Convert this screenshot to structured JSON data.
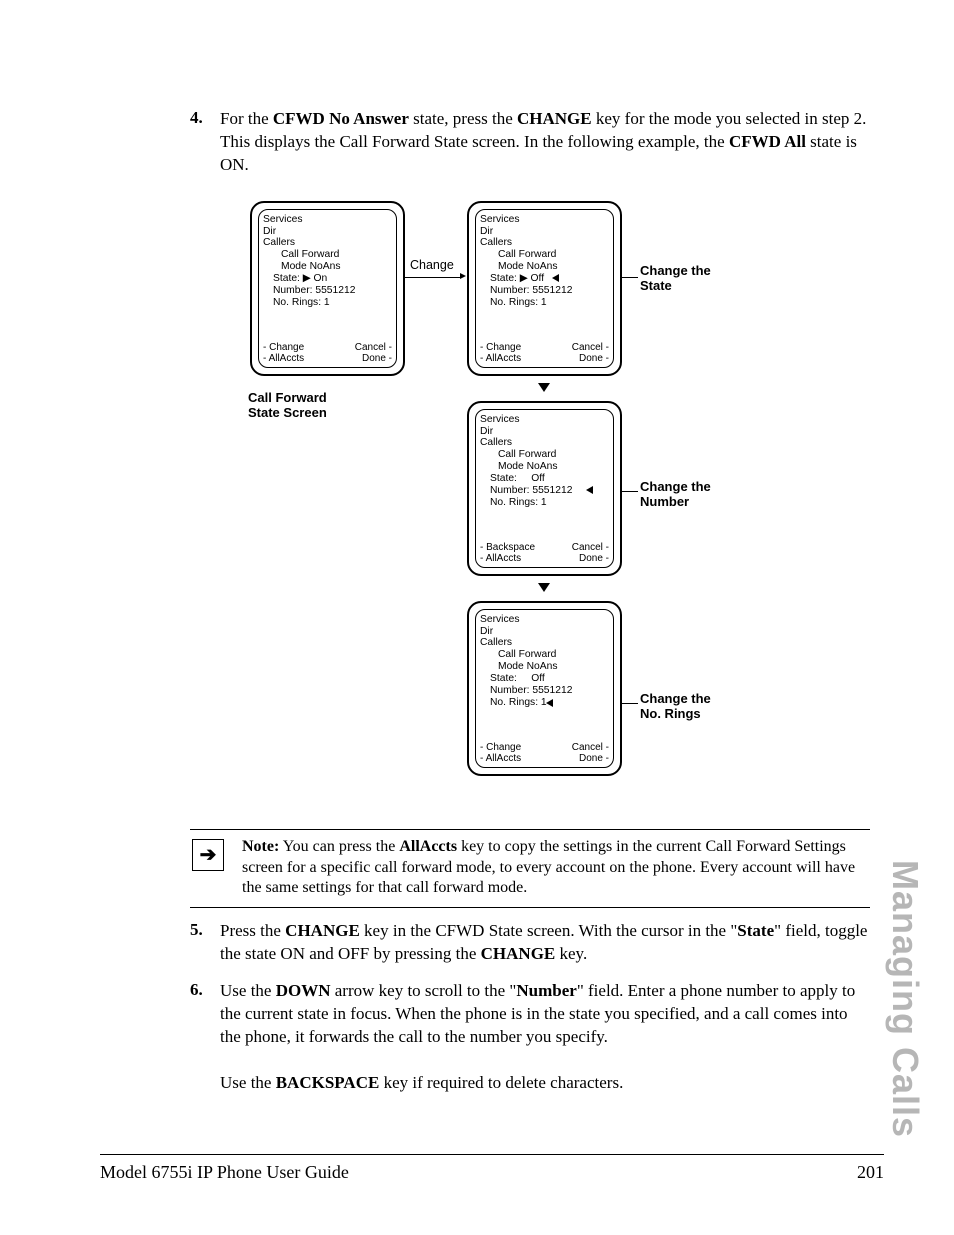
{
  "sidetab": "Managing Calls",
  "footer": {
    "left": "Model 6755i IP Phone User Guide",
    "right": "201"
  },
  "steps": {
    "s4": {
      "num": "4.",
      "p1a": "For the ",
      "p1b": "CFWD No Answer",
      "p1c": " state, press the ",
      "p1d": "CHANGE",
      "p1e": " key for the mode you selected in step 2. This displays the Call Forward State screen. In the following example, the ",
      "p1f": "CFWD All",
      "p1g": " state is ON."
    },
    "s5": {
      "num": "5.",
      "a": "Press the ",
      "b": "CHANGE",
      "c": " key in the CFWD State screen. With the cursor in the \"",
      "d": "State",
      "e": "\" field, toggle the state ON and OFF by pressing the ",
      "f": "CHANGE",
      "g": " key."
    },
    "s6": {
      "num": "6.",
      "a": "Use the ",
      "b": "DOWN",
      "c": " arrow key to scroll to the \"",
      "d": "Number",
      "e": "\" field. Enter a phone number to apply to the current state in focus. When the phone is in the state you specified, and a call comes into the phone, it forwards the call to the number you specify.",
      "p2a": "Use the ",
      "p2b": "BACKSPACE",
      "p2c": " key if required to delete characters."
    }
  },
  "note": {
    "lead": "Note:",
    "a": " You can press the ",
    "b": "AllAccts",
    "c": " key to copy the settings in the current Call Forward Settings screen for a specific call forward mode, to every account on the phone. Every account will have the same settings for that call forward mode."
  },
  "diagram": {
    "change_lbl": "Change",
    "label_state_screen": "Call Forward\nState Screen",
    "label_change_state": "Change the\nState",
    "label_change_number": "Change the\nNumber",
    "label_change_rings": "Change the\nNo. Rings",
    "s1": {
      "l0": "Services",
      "l1": "Dir",
      "l2": "Callers",
      "l3": "Call Forward",
      "l4": "Mode NoAns",
      "l5": "State: ▶ On",
      "l6": "Number: 5551212",
      "l7": "No. Rings: 1",
      "sk1l": "Change",
      "sk1r": "Cancel",
      "sk2l": "AllAccts",
      "sk2r": "Done"
    },
    "s2": {
      "l0": "Services",
      "l1": "Dir",
      "l2": "Callers",
      "l3": "Call Forward",
      "l4": "Mode NoAns",
      "l5": "State: ▶ Off",
      "l6": "Number: 5551212",
      "l7": "No. Rings: 1",
      "sk1l": "Change",
      "sk1r": "Cancel",
      "sk2l": "AllAccts",
      "sk2r": "Done"
    },
    "s3": {
      "l0": "Services",
      "l1": "Dir",
      "l2": "Callers",
      "l3": "Call Forward",
      "l4": "Mode NoAns",
      "l5": "State:     Off",
      "l6": "Number: 5551212",
      "l7": "No. Rings: 1",
      "sk1l": "Backspace",
      "sk1r": "Cancel",
      "sk2l": "AllAccts",
      "sk2r": "Done"
    },
    "s4": {
      "l0": "Services",
      "l1": "Dir",
      "l2": "Callers",
      "l3": "Call Forward",
      "l4": "Mode NoAns",
      "l5": "State:     Off",
      "l6": "Number: 5551212",
      "l7": "No. Rings: 1",
      "sk1l": "Change",
      "sk1r": "Cancel",
      "sk2l": "AllAccts",
      "sk2r": "Done"
    }
  }
}
